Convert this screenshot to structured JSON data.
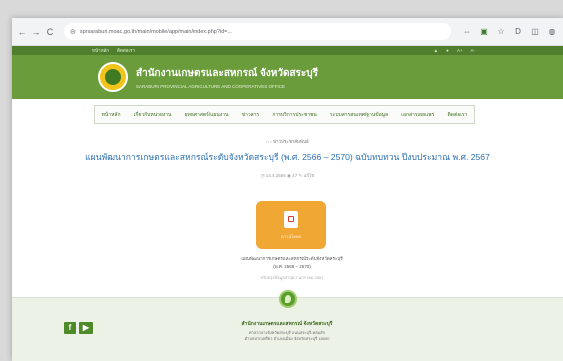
{
  "browser": {
    "back": "←",
    "forward": "→",
    "reload": "C",
    "url": "sprsaraburi.moac.go.th/main/mobile/app/main/index.php?id=...",
    "tools": {
      "translate": "⇔",
      "extension1": "▣",
      "star": "☆",
      "reader": "D",
      "tabs": "◫",
      "profile": "◍"
    }
  },
  "topstrip": {
    "left1": "หน้าหลัก",
    "left2": "ติดต่อเรา",
    "right1": "▲",
    "right2": "●",
    "right3": "A+",
    "right4": "A-"
  },
  "site": {
    "title_th": "สำนักงานเกษตรและสหกรณ์ จังหวัดสระบุรี",
    "title_en": "SARABURI PROVINCIAL AGRICULTURE AND COOPERATIVES OFFICE"
  },
  "menu": [
    "หน้าหลัก",
    "เกี่ยวกับหน่วยงาน",
    "ยุทธศาสตร์/แผนงาน",
    "ข่าวสาร",
    "การบริการประชาชน",
    "ระบบสารสนเทศ/ฐานข้อมูล",
    "เอกสารเผยแพร่",
    "ติดต่อเรา"
  ],
  "breadcrumb": "⌂  ›  ข่าวประชาสัมพันธ์",
  "page": {
    "title": "แผนพัฒนาการเกษตรและสหกรณ์ระดับจังหวัดสระบุรี (พ.ศ. 2566 – 2570) ฉบับทบทวน ปีงบประมาณ พ.ศ. 2567",
    "meta": "◷ 14.4.2566   ◉ 47   ✎ แก้ไข"
  },
  "document": {
    "card_label": "ดาวน์โหลด",
    "filename": "แผนพัฒนาการเกษตรและสหกรณ์ระดับจังหวัดสระบุรี",
    "range": "(พ.ศ. 2566 – 2570)",
    "updated": "ปรับปรุงข้อมูลล่าสุด 2 มกราคม 2567"
  },
  "footer": {
    "facebook": "f",
    "youtube": "▶",
    "name": "สำนักงานเกษตรและสหกรณ์ จังหวัดสระบุรี",
    "address1": "ศาลากลางจังหวัดสระบุรี ถนนสระบุรี-หล่มสัก",
    "address2": "ตำบลปากเพรียว อำเภอเมือง จังหวัดสระบุรี 18000"
  }
}
